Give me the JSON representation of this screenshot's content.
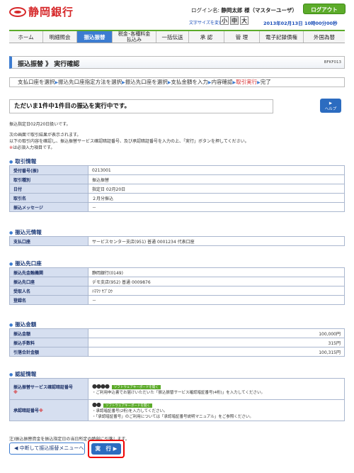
{
  "header": {
    "bank_name": "静岡銀行",
    "login_label": "ログイン名:",
    "user_name": "静岡太郎 様（マスターユーザ）",
    "logout": "ログアウト",
    "font_size_label": "文字サイズを変更",
    "font_small": "小",
    "font_medium": "中",
    "font_large": "大",
    "datetime": "2013年02月13日 10時00分00秒"
  },
  "nav": {
    "items": [
      "ホーム",
      "明細照会",
      "振込振替",
      "税金･各種料金払込み",
      "一括伝送",
      "承 認",
      "管 理",
      "電子記録債権",
      "外国為替"
    ],
    "two_line_top": "税金･各種料金",
    "two_line_bottom": "払込み"
  },
  "page": {
    "title": "振込振替 》 実行確認",
    "screen_code": "BFKF013"
  },
  "steps": [
    "支払口座を選択",
    "振込先口座指定方法を選択",
    "振込先口座を選択",
    "支払金額を入力",
    "内容確認",
    "取引実行",
    "完了"
  ],
  "message": "ただいま1件中1件目の振込を実行中です。",
  "help": "ヘルプ",
  "info": {
    "exec_date": "振込指定日02月20日扱いです。",
    "line1": "次の画面で取引結果が表示されます。",
    "line2": "以下の取引内容を確認し、振込振替サービス確認暗証番号、及び承認暗証番号を入力の上、「実行」ボタンを押してください。",
    "line3": "は必須入力項目です。",
    "req_mark": "※"
  },
  "transaction": {
    "heading": "取引情報",
    "rows": [
      [
        "受付番号(振)",
        "0213001"
      ],
      [
        "取引種別",
        "振込振替"
      ],
      [
        "日付",
        "指定日 02月20日"
      ],
      [
        "取引名",
        "２月分振込"
      ],
      [
        "振込メッセージ",
        "－"
      ]
    ]
  },
  "payer": {
    "heading": "振込元情報",
    "rows": [
      [
        "支払口座",
        "サービスセンター支店(951) 普通 0001234 代表口座"
      ]
    ]
  },
  "payee": {
    "heading": "振込先口座",
    "rows": [
      [
        "振込先金融機関",
        "静岡銀行(0149)"
      ],
      [
        "振込先口座",
        "デモ支店(952) 普通 0009876"
      ],
      [
        "受取人名",
        "ﾊﾏﾏﾂ ｻﾌﾞﾛｳ"
      ],
      [
        "登録名",
        "－"
      ]
    ]
  },
  "amount": {
    "heading": "振込金額",
    "rows": [
      [
        "振込金額",
        "100,000円"
      ],
      [
        "振込手数料",
        "315円"
      ],
      [
        "引落合計金額",
        "100,315円"
      ]
    ]
  },
  "auth": {
    "heading": "認証情報",
    "row1_label": "振込振替サービス確認暗証番号",
    "row1_dots": "●●●●",
    "row1_kb": "ソフトウェアキーボードを開く",
    "row1_text": "・ご利用申込書でお届けいただいた「振込振替サービス確認暗証番号(4桁)」を入力してください。",
    "row2_label": "承認暗証番号",
    "row2_dots": "●●",
    "row2_kb": "ソフトウェアキーボードを開く",
    "row2_text1": "・承認暗証番号(2桁)を入力してください。",
    "row2_text2": "・「承認暗証番号」のご利用については「承認暗証番号説明マニュアル」をご参照ください。",
    "req_mark": "※"
  },
  "footer": {
    "note": "注)振込振替資金を振込指定日の当日所定の時刻に引落します。",
    "back_button": "中断して振込振替メニューへ",
    "exec_button": "実　行"
  }
}
